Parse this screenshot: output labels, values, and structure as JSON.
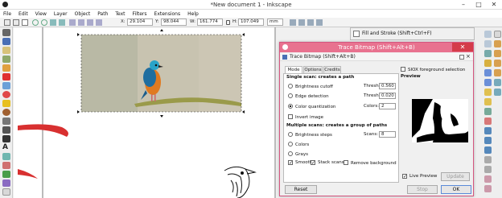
{
  "window": {
    "title": "*New document 1 - Inkscape",
    "minimize": "–",
    "maximize": "□",
    "close": "✕"
  },
  "menu": [
    "File",
    "Edit",
    "View",
    "Layer",
    "Object",
    "Path",
    "Text",
    "Filters",
    "Extensions",
    "Help"
  ],
  "controls": {
    "x_label": "X:",
    "x_value": "29.104",
    "y_label": "Y:",
    "y_value": "98.044",
    "w_label": "W:",
    "w_value": "161.774",
    "h_label": "H:",
    "h_value": "107.049",
    "unit": "mm"
  },
  "fill_panel": {
    "title": "Fill and Stroke (Shift+Ctrl+F)"
  },
  "dialog": {
    "outer_title": "Trace Bitmap (Shift+Alt+B)",
    "inner_title": "Trace Bitmap (Shift+Alt+B)",
    "tabs": [
      "Mode",
      "Options",
      "Credits"
    ],
    "siox_label": "SIOX foreground selection",
    "preview_label": "Preview",
    "single_header": "Single scan: creates a path",
    "brightness_label": "Brightness cutoff",
    "threshold1_label": "Threshold:",
    "threshold1_value": "0.560",
    "edge_label": "Edge detection",
    "threshold2_label": "Threshold:",
    "threshold2_value": "0.020",
    "color_q_label": "Color quantization",
    "colors_label": "Colors:",
    "colors_value": "2",
    "invert_label": "Invert image",
    "multi_header": "Multiple scans: creates a group of paths",
    "bsteps_label": "Brightness steps",
    "scans_label": "Scans:",
    "scans_value": "8",
    "colors_multi_label": "Colors",
    "grays_label": "Grays",
    "smooth_label": "Smooth",
    "stack_label": "Stack scans",
    "remove_bg_label": "Remove background",
    "live_preview_label": "Live Preview",
    "update_label": "Update",
    "reset_label": "Reset",
    "stop_label": "Stop",
    "ok_label": "OK",
    "checkmark": "✓"
  }
}
